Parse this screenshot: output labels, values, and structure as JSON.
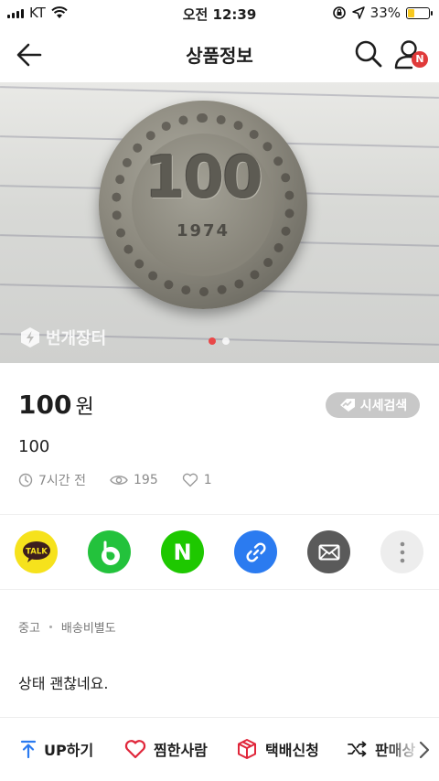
{
  "status_bar": {
    "carrier": "KT",
    "time": "오전 12:39",
    "battery_percent": "33%",
    "battery_level": 0.33
  },
  "nav": {
    "title": "상품정보",
    "badge": "N"
  },
  "photo": {
    "watermark": "번개장터",
    "coin_value": "100",
    "coin_year": "1974",
    "page_count": 2,
    "active_page": 1
  },
  "product": {
    "price": "100",
    "price_unit": "원",
    "market_button": "시세검색",
    "title": "100",
    "posted": "7시간 전",
    "views": "195",
    "likes": "1"
  },
  "share": {
    "items": [
      "kakao-talk",
      "band",
      "naver",
      "link",
      "mail",
      "more"
    ],
    "kakao_label": "TALK",
    "naver_label": "N"
  },
  "tags": {
    "condition": "중고",
    "shipping": "배송비별도"
  },
  "description": "상태 괜찮네요.",
  "toolbar": {
    "up": "UP하기",
    "liked": "찜한사람",
    "delivery": "택배신청",
    "status": "판매상"
  },
  "colors": {
    "accent": "#e94848",
    "heart": "#e0263a",
    "up_arrow": "#2b7bf0"
  }
}
